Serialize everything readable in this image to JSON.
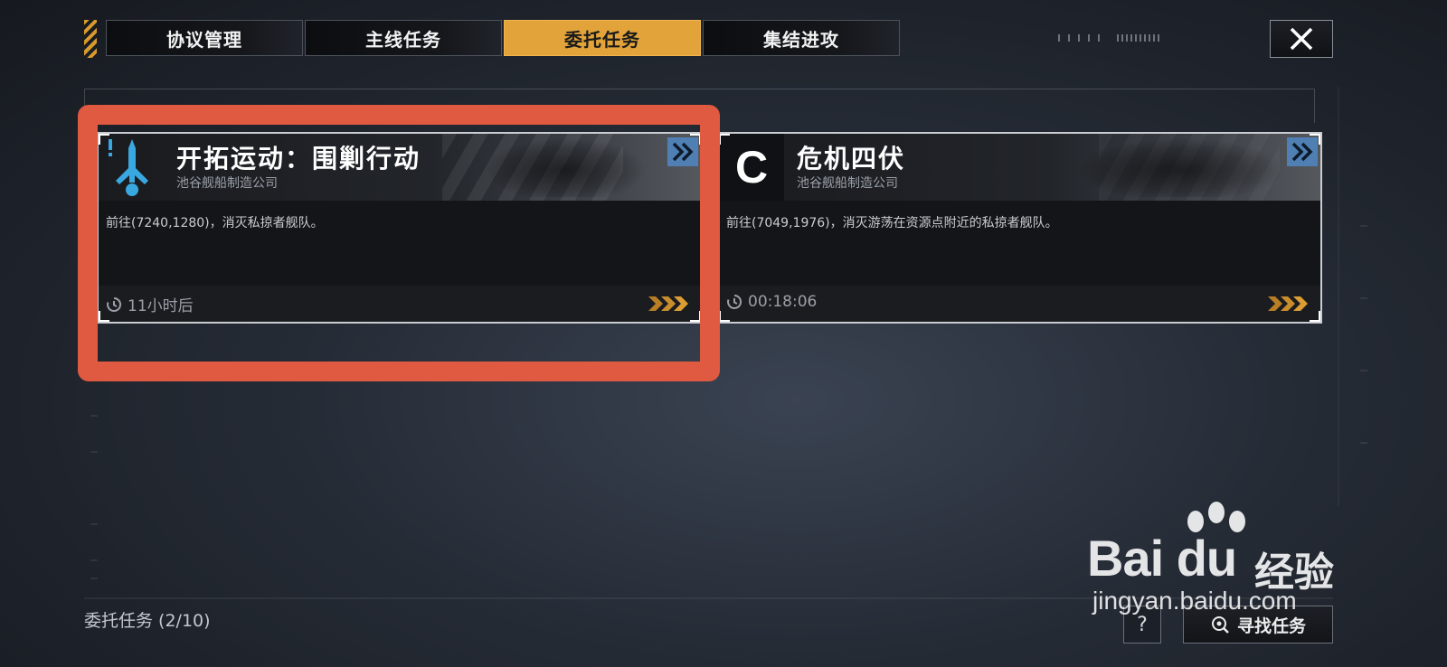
{
  "tabs": [
    {
      "label": "协议管理",
      "active": false
    },
    {
      "label": "主线任务",
      "active": false
    },
    {
      "label": "委托任务",
      "active": true
    },
    {
      "label": "集结进攻",
      "active": false
    }
  ],
  "cards": [
    {
      "icon": "faction-emblem-icon",
      "title": "开拓运动：围剿行动",
      "company": "池谷舰船制造公司",
      "description": "前往(7240,1280)，消灭私掠者舰队。",
      "timer": "11小时后"
    },
    {
      "icon": "rank-c-icon",
      "rank_letter": "C",
      "title": "危机四伏",
      "company": "池谷舰船制造公司",
      "description": "前往(7049,1976)，消灭游荡在资源点附近的私掠者舰队。",
      "timer": "00:18:06"
    }
  ],
  "footer": {
    "count_label": "委托任务 (2/10)",
    "help_label": "?",
    "find_label": "寻找任务"
  },
  "watermark": {
    "brand": "Bai du",
    "brand_cn": "经验",
    "url": "jingyan.baidu.com"
  },
  "colors": {
    "accent": "#e2a33a",
    "highlight": "#e05a41",
    "arrow_button": "#4f7fb3",
    "emblem": "#3aa8e0"
  }
}
